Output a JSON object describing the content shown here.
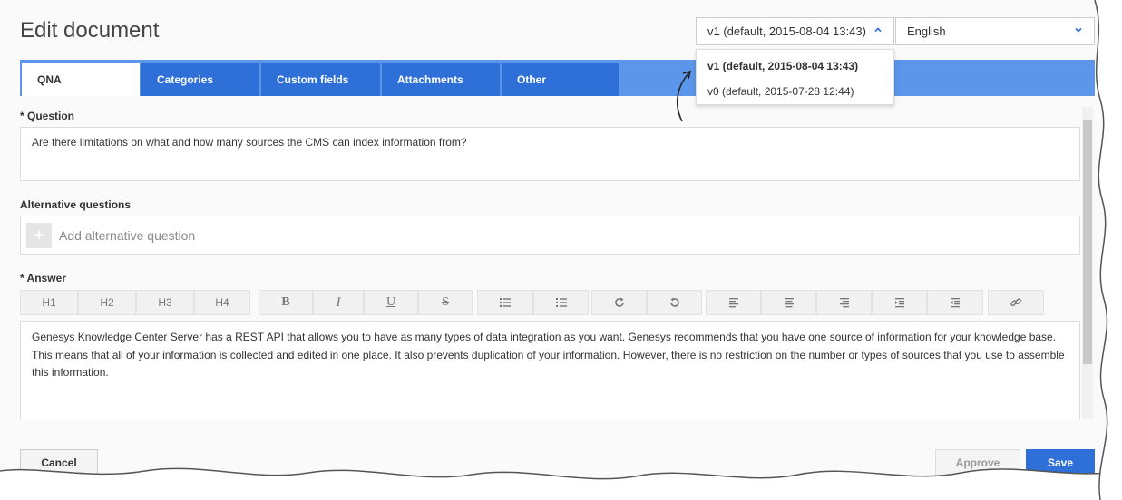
{
  "page": {
    "title": "Edit document"
  },
  "version_select": {
    "value": "v1 (default, 2015-08-04 13:43)",
    "options": [
      "v1 (default, 2015-08-04 13:43)",
      "v0 (default, 2015-07-28 12:44)"
    ]
  },
  "language_select": {
    "value": "English"
  },
  "tabs": [
    {
      "label": "QNA"
    },
    {
      "label": "Categories"
    },
    {
      "label": "Custom fields"
    },
    {
      "label": "Attachments"
    },
    {
      "label": "Other"
    }
  ],
  "question": {
    "label": "* Question",
    "value": "Are there limitations on what and how many sources the CMS can index information from?"
  },
  "alternative_questions": {
    "label": "Alternative questions",
    "add_symbol": "+",
    "placeholder": "Add alternative question"
  },
  "answer": {
    "label": "* Answer",
    "toolbar": {
      "h1": "H1",
      "h2": "H2",
      "h3": "H3",
      "h4": "H4",
      "bold": "B",
      "italic": "I",
      "underline": "U",
      "strike": "S"
    },
    "value": "Genesys Knowledge Center Server has a REST API that allows you to have as many types of data integration as you want. Genesys recommends that you have one source of information for your knowledge base. This means that all of your information is collected and edited in one place. It also prevents duplication of your information. However, there is no restriction on the number or types of sources that you use to assemble this information."
  },
  "actions": {
    "cancel": "Cancel",
    "approve": "Approve",
    "save": "Save"
  },
  "colors": {
    "accent": "#2e6fd8",
    "tab_bar": "#5b96ea"
  }
}
